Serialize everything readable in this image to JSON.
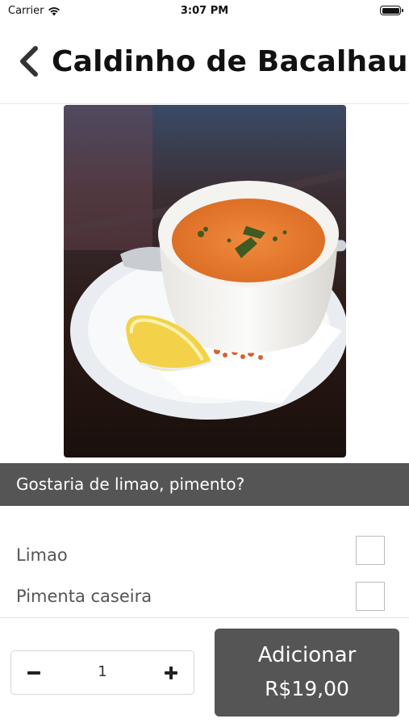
{
  "status_bar": {
    "carrier": "Carrier",
    "time": "3:07 PM"
  },
  "navbar": {
    "back_icon": "chevron-left-icon",
    "title": "Caldinho de Bacalhau"
  },
  "product_image": {
    "subject": "soup-photo"
  },
  "options_section": {
    "title": "Gostaria de limao, pimento?",
    "options": [
      {
        "label": "Limao",
        "checked": false
      },
      {
        "label": "Pimenta caseira",
        "checked": false
      }
    ]
  },
  "order": {
    "quantity": "1",
    "minus_icon": "minus-icon",
    "plus_icon": "plus-icon",
    "add_label": "Adicionar",
    "price": "R$19,00"
  },
  "colors": {
    "header_bg": "#555555",
    "button_bg": "#555555",
    "accent": "#333333"
  }
}
